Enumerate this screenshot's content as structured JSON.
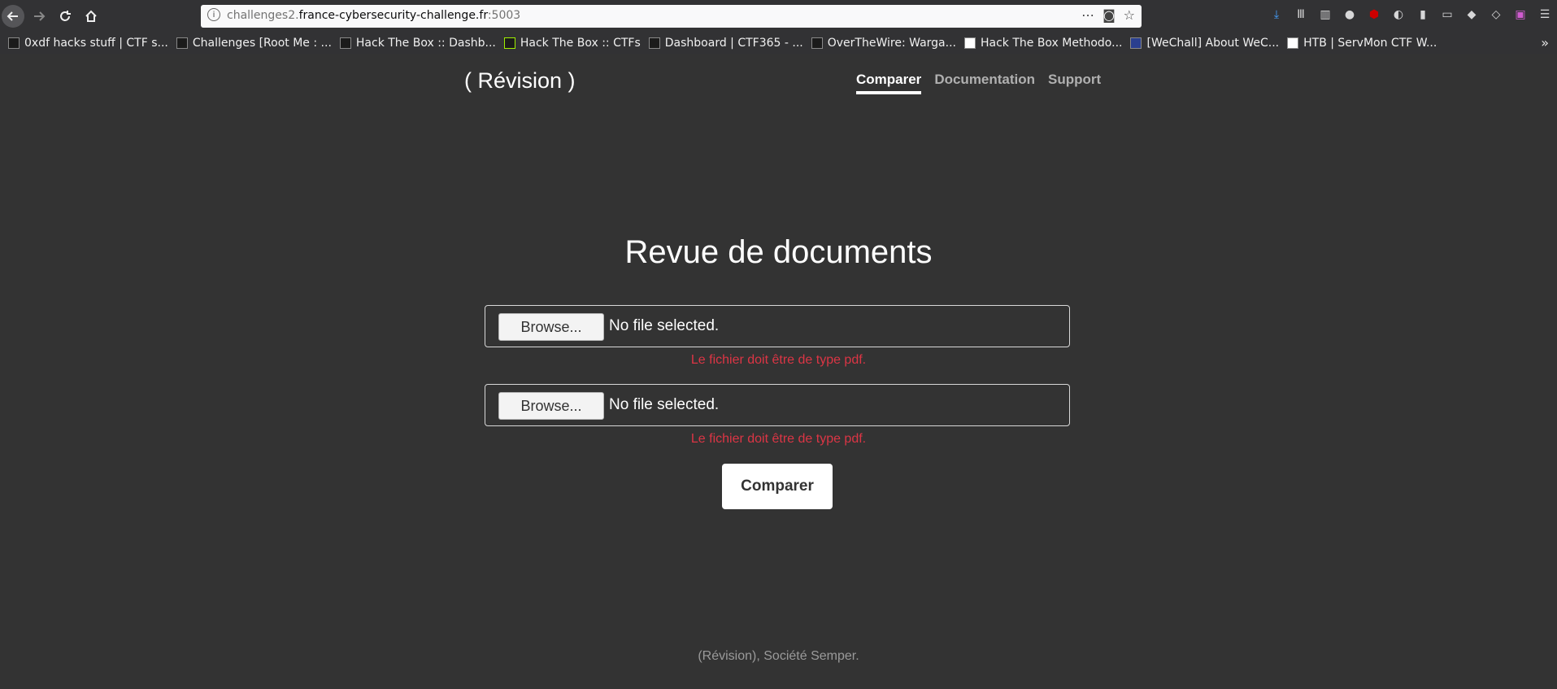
{
  "browser": {
    "url_prefix": "challenges2.",
    "url_host": "france-cybersecurity-challenge.fr",
    "url_suffix": ":5003",
    "bookmarks": [
      "0xdf hacks stuff | CTF s...",
      "Challenges [Root Me : ...",
      "Hack The Box :: Dashb...",
      "Hack The Box :: CTFs",
      "Dashboard | CTF365 - ...",
      "OverTheWire: Warga...",
      "Hack The Box Methodo...",
      "[WeChall] About WeC...",
      "HTB | ServMon CTF W..."
    ],
    "bookmark_more_icon": "chevron-double-right-icon"
  },
  "page": {
    "brand": "( Révision )",
    "nav": {
      "compare": "Comparer",
      "docs": "Documentation",
      "support": "Support"
    },
    "title": "Revue de documents",
    "file1": {
      "button": "Browse...",
      "status": "No file selected.",
      "error": "Le fichier doit être de type pdf."
    },
    "file2": {
      "button": "Browse...",
      "status": "No file selected.",
      "error": "Le fichier doit être de type pdf."
    },
    "submit": "Comparer",
    "footer": "(Révision), Société Semper."
  },
  "colors": {
    "background": "#333333",
    "error": "#dc3545",
    "text": "#ffffff"
  }
}
